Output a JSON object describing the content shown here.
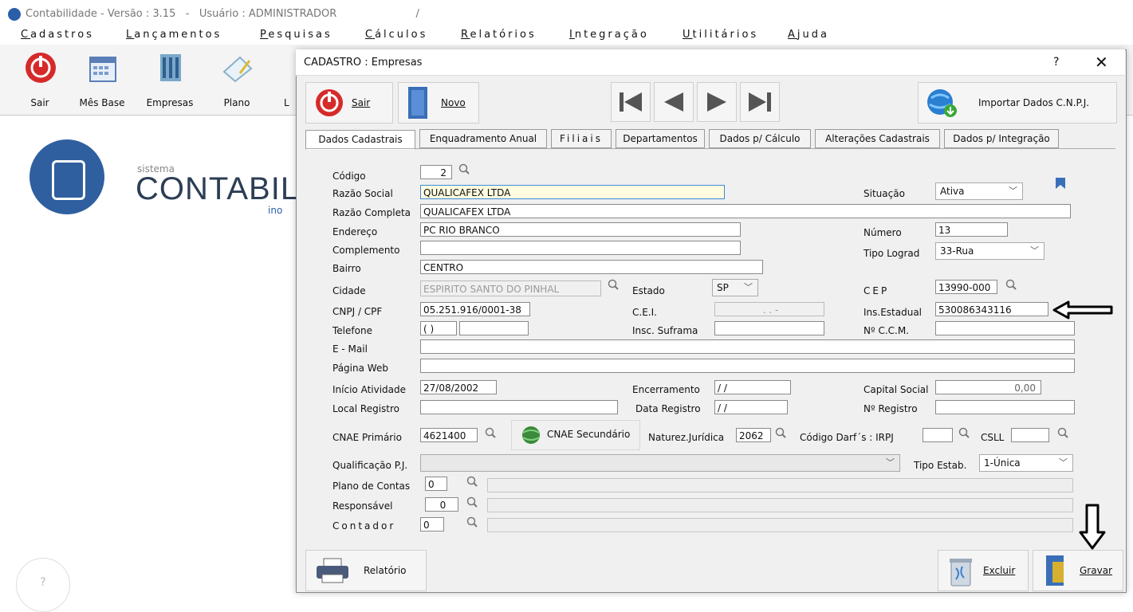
{
  "app": {
    "title": "Contabilidade - Versão : 3.15   -   Usuário : ADMINISTRADOR                        /",
    "menu": [
      "Cadastros",
      "Lançamentos",
      "Pesquisas",
      "Cálculos",
      "Relatórios",
      "Integração",
      "Utilitários",
      "Ajuda"
    ],
    "toolbar": [
      "Sair",
      "Mês Base",
      "Empresas",
      "Plano",
      "L"
    ],
    "splash": {
      "sistema": "sistema",
      "brand": "CONTABILI",
      "ino": "ino",
      "help": "?"
    }
  },
  "dialog": {
    "title": "CADASTRO : Empresas",
    "help": "?",
    "close": "✕",
    "sair": "Sair",
    "novo": "Novo",
    "importar": "Importar Dados C.N.P.J.",
    "relatorio": "Relatório",
    "excluir": "Excluir",
    "gravar": "Gravar",
    "cnae_secundario": "CNAE Secundário",
    "tabs": [
      "Dados Cadastrais",
      "Enquadramento Anual",
      "Filiais",
      "Departamentos",
      "Dados p/ Cálculo",
      "Alterações Cadastrais",
      "Dados p/ Integração"
    ]
  },
  "labels": {
    "codigo": "Código",
    "razao_social": "Razão Social",
    "razao_completa": "Razão Completa",
    "endereco": "Endereço",
    "complemento": "Complemento",
    "bairro": "Bairro",
    "cidade": "Cidade",
    "cnpj": "CNPJ / CPF",
    "telefone": "Telefone",
    "email": "E - Mail",
    "pagina_web": "Página Web",
    "inicio_atividade": "Início Atividade",
    "local_registro": "Local Registro",
    "cnae_primario": "CNAE Primário",
    "qualificacao": "Qualificação P.J.",
    "plano_contas": "Plano de Contas",
    "responsavel": "Responsável",
    "contador": "Contador",
    "estado": "Estado",
    "cei": "C.E.I.",
    "insc_suframa": "Insc. Suframa",
    "encerramento": "Encerramento",
    "data_registro": "Data Registro",
    "natureza": "Naturez.Jurídica",
    "codigo_darf": "Código Darf´s : IRPJ",
    "csll": "CSLL",
    "situacao": "Situação",
    "numero": "Número",
    "tipo_lograd": "Tipo Lograd",
    "cep": "CEP",
    "ins_estadual": "Ins.Estadual",
    "ccm": "Nº C.C.M.",
    "capital_social": "Capital Social",
    "n_registro": "Nº Registro",
    "tipo_estab": "Tipo Estab."
  },
  "values": {
    "codigo": "2",
    "razao_social": "QUALICAFEX LTDA",
    "razao_completa": "QUALICAFEX LTDA",
    "endereco": "PC RIO BRANCO",
    "complemento": "",
    "bairro": "CENTRO",
    "cidade": "ESPIRITO SANTO DO PINHAL",
    "estado": "SP",
    "cnpj": "05.251.916/0001-38",
    "cei": ".   .   -",
    "telefone_ddd": "( )",
    "telefone": "",
    "insc_suframa": "",
    "email": "",
    "pagina_web": "",
    "inicio_atividade": "27/08/2002",
    "encerramento": "/ /",
    "local_registro": "",
    "data_registro": "/ /",
    "cnae_primario": "4621400",
    "natureza": "2062",
    "irpj": "",
    "csll": "",
    "qualificacao": "",
    "plano_contas": "0",
    "responsavel": "0",
    "contador": "0",
    "situacao": "Ativa",
    "numero": "13",
    "tipo_lograd": "33-Rua",
    "cep": "13990-000",
    "ins_estadual": "530086343116",
    "ccm": "",
    "capital_social": "0,00",
    "n_registro": "",
    "tipo_estab": "1-Única"
  },
  "colors": {
    "accent_blue": "#2a5fa8",
    "highlight_field": "#fffce0",
    "power_red": "#d62a2a"
  }
}
